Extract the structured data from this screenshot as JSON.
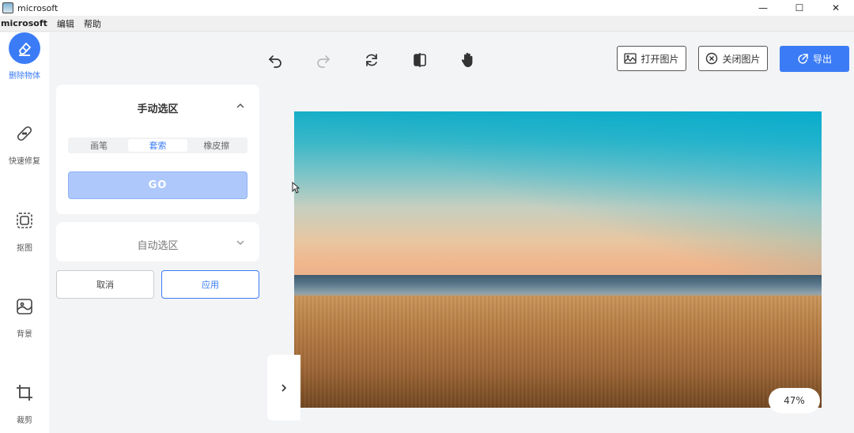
{
  "window": {
    "title": "microsoft",
    "controls": [
      "—",
      "☐",
      "✕"
    ]
  },
  "menu": {
    "items": [
      "microsoft",
      "编辑",
      "帮助"
    ]
  },
  "sidebar": {
    "items": [
      {
        "label": "删除物体",
        "icon": "eraser-icon",
        "active": true
      },
      {
        "label": "快速修复",
        "icon": "bandage-icon",
        "active": false
      },
      {
        "label": "抠图",
        "icon": "cutout-icon",
        "active": false
      },
      {
        "label": "背景",
        "icon": "background-icon",
        "active": false
      },
      {
        "label": "裁剪",
        "icon": "crop-icon",
        "active": false
      }
    ]
  },
  "toolbar": {
    "tools": [
      "undo-icon",
      "redo-icon",
      "refresh-icon",
      "compare-icon",
      "hand-icon"
    ],
    "open_label": "打开图片",
    "close_label": "关闭图片",
    "export_label": "导出"
  },
  "manual_panel": {
    "title": "手动选区",
    "options": [
      "画笔",
      "套索",
      "橡皮擦"
    ],
    "selected": "套索",
    "go_label": "GO"
  },
  "auto_panel": {
    "title": "自动选区"
  },
  "actions": {
    "cancel_label": "取消",
    "apply_label": "应用"
  },
  "canvas": {
    "zoom": "47%"
  },
  "colors": {
    "accent": "#3b7cf6",
    "go_button": "#aec8fb"
  }
}
